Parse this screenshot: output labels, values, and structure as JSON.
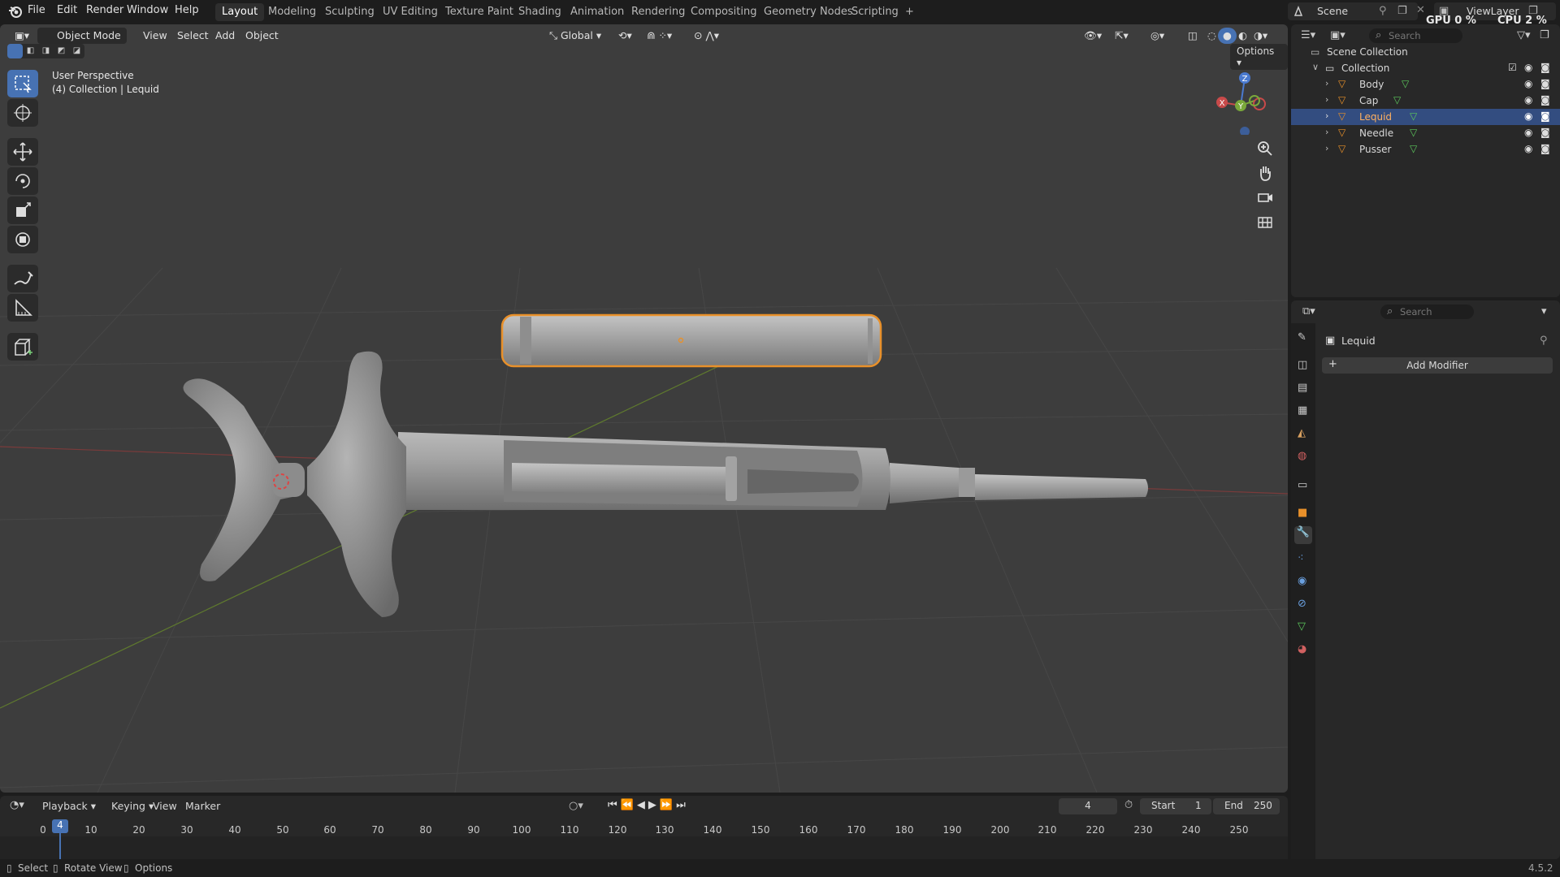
{
  "topbar": {
    "menus": [
      "File",
      "Edit",
      "Render",
      "Window",
      "Help"
    ],
    "workspaces": [
      "Layout",
      "Modeling",
      "Sculpting",
      "UV Editing",
      "Texture Paint",
      "Shading",
      "Animation",
      "Rendering",
      "Compositing",
      "Geometry Nodes",
      "Scripting"
    ],
    "active_workspace": "Layout",
    "add_workspace": "+",
    "scene_label": "Scene",
    "viewlayer_label": "ViewLayer",
    "gpu_label": "GPU",
    "gpu_value": "0 %",
    "cpu_label": "CPU",
    "cpu_value": "2 %"
  },
  "viewport": {
    "mode": "Object Mode",
    "menu_view": "View",
    "menu_select": "Select",
    "menu_add": "Add",
    "menu_object": "Object",
    "orientation": "Global",
    "options": "Options",
    "info_line1": "User Perspective",
    "info_line2": "(4) Collection | Lequid",
    "gizmo_x": "X",
    "gizmo_y": "Y",
    "gizmo_z": "Z"
  },
  "outliner": {
    "search_placeholder": "Search",
    "scene_collection": "Scene Collection",
    "collection": "Collection",
    "items": [
      {
        "name": "Body",
        "selected": false
      },
      {
        "name": "Cap",
        "selected": false
      },
      {
        "name": "Lequid",
        "selected": true
      },
      {
        "name": "Needle",
        "selected": false
      },
      {
        "name": "Pusser",
        "selected": false
      }
    ]
  },
  "properties": {
    "search_placeholder": "Search",
    "object_name": "Lequid",
    "add_modifier": "Add Modifier"
  },
  "timeline": {
    "playback": "Playback",
    "keying": "Keying",
    "view": "View",
    "marker": "Marker",
    "current_frame": "4",
    "start_label": "Start",
    "start_value": "1",
    "end_label": "End",
    "end_value": "250",
    "ticks": [
      "0",
      "10",
      "20",
      "30",
      "40",
      "50",
      "60",
      "70",
      "80",
      "90",
      "100",
      "110",
      "120",
      "130",
      "140",
      "150",
      "160",
      "170",
      "180",
      "190",
      "200",
      "210",
      "220",
      "230",
      "240",
      "250"
    ],
    "playhead_label": "4"
  },
  "statusbar": {
    "select": "Select",
    "rotate": "Rotate View",
    "options": "Options",
    "version": "4.5.2"
  },
  "colors": {
    "accent": "#4772b3",
    "selection_outline": "#e8902a",
    "x_axis": "#c84a4a",
    "y_axis": "#7aa83a",
    "z_axis": "#4a7ad0"
  }
}
